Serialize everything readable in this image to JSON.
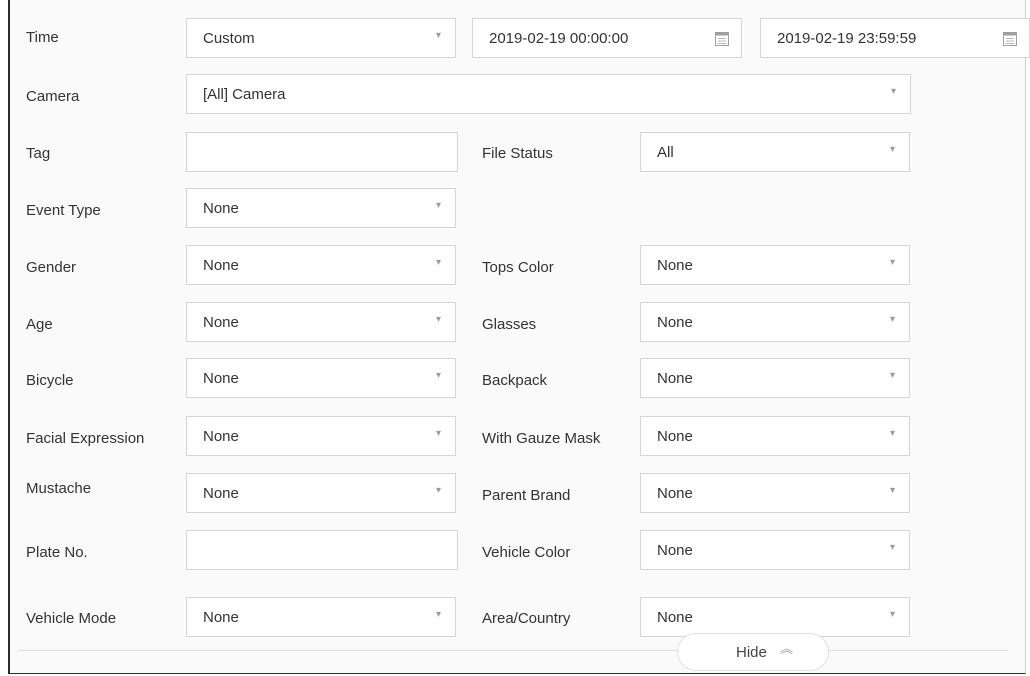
{
  "fields": {
    "time": {
      "label": "Time",
      "mode": "Custom",
      "start": "2019-02-19 00:00:00",
      "end": "2019-02-19 23:59:59"
    },
    "camera": {
      "label": "Camera",
      "value": "[All] Camera"
    },
    "tag": {
      "label": "Tag",
      "value": ""
    },
    "file_status": {
      "label": "File Status",
      "value": "All"
    },
    "event_type": {
      "label": "Event Type",
      "value": "None"
    },
    "gender": {
      "label": "Gender",
      "value": "None"
    },
    "tops_color": {
      "label": "Tops Color",
      "value": "None"
    },
    "age": {
      "label": "Age",
      "value": "None"
    },
    "glasses": {
      "label": "Glasses",
      "value": "None"
    },
    "bicycle": {
      "label": "Bicycle",
      "value": "None"
    },
    "backpack": {
      "label": "Backpack",
      "value": "None"
    },
    "facial_expression": {
      "label": "Facial Expression",
      "value": "None"
    },
    "gauze_mask": {
      "label": "With Gauze Mask",
      "value": "None"
    },
    "mustache": {
      "label": "Mustache",
      "value": "None"
    },
    "parent_brand": {
      "label": "Parent Brand",
      "value": "None"
    },
    "plate_no": {
      "label": "Plate No.",
      "value": ""
    },
    "vehicle_color": {
      "label": "Vehicle Color",
      "value": "None"
    },
    "vehicle_mode": {
      "label": "Vehicle Mode",
      "value": "None"
    },
    "area_country": {
      "label": "Area/Country",
      "value": "None"
    }
  },
  "hide_button": {
    "label": "Hide",
    "icon": "chevron-double-up-icon"
  },
  "icons": {
    "dropdown": "chevron-down-icon",
    "calendar": "calendar-icon"
  }
}
